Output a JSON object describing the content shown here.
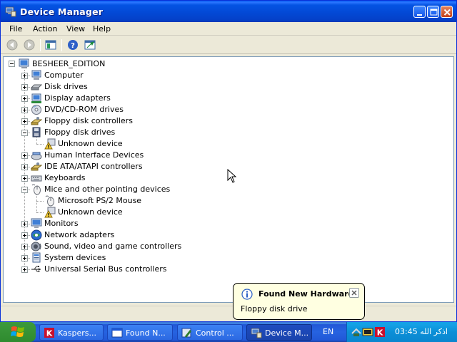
{
  "window": {
    "title": "Device Manager"
  },
  "menubar": {
    "items": [
      "File",
      "Action",
      "View",
      "Help"
    ]
  },
  "tree": {
    "root": "BESHEER_EDITION",
    "items": [
      {
        "label": "Computer",
        "icon": "computer-icon",
        "level": 1,
        "expander": "plus"
      },
      {
        "label": "Disk drives",
        "icon": "disk-drive-icon",
        "level": 1,
        "expander": "plus"
      },
      {
        "label": "Display adapters",
        "icon": "display-adapter-icon",
        "level": 1,
        "expander": "plus"
      },
      {
        "label": "DVD/CD-ROM drives",
        "icon": "cdrom-icon",
        "level": 1,
        "expander": "plus"
      },
      {
        "label": "Floppy disk controllers",
        "icon": "controller-icon",
        "level": 1,
        "expander": "plus"
      },
      {
        "label": "Floppy disk drives",
        "icon": "floppy-drive-icon",
        "level": 1,
        "expander": "minus"
      },
      {
        "label": "Unknown device",
        "icon": "unknown-device-warning-icon",
        "level": 2,
        "expander": "none"
      },
      {
        "label": "Human Interface Devices",
        "icon": "hid-icon",
        "level": 1,
        "expander": "plus"
      },
      {
        "label": "IDE ATA/ATAPI controllers",
        "icon": "controller-icon",
        "level": 1,
        "expander": "plus"
      },
      {
        "label": "Keyboards",
        "icon": "keyboard-icon",
        "level": 1,
        "expander": "plus"
      },
      {
        "label": "Mice and other pointing devices",
        "icon": "mouse-icon",
        "level": 1,
        "expander": "minus"
      },
      {
        "label": "Microsoft PS/2 Mouse",
        "icon": "mouse-icon",
        "level": 2,
        "expander": "none"
      },
      {
        "label": "Unknown device",
        "icon": "unknown-device-warning-icon",
        "level": 2,
        "expander": "none"
      },
      {
        "label": "Monitors",
        "icon": "monitor-icon",
        "level": 1,
        "expander": "plus"
      },
      {
        "label": "Network adapters",
        "icon": "network-adapter-icon",
        "level": 1,
        "expander": "plus"
      },
      {
        "label": "Sound, video and game controllers",
        "icon": "sound-icon",
        "level": 1,
        "expander": "plus"
      },
      {
        "label": "System devices",
        "icon": "system-device-icon",
        "level": 1,
        "expander": "plus"
      },
      {
        "label": "Universal Serial Bus controllers",
        "icon": "usb-icon",
        "level": 1,
        "expander": "plus"
      }
    ]
  },
  "balloon": {
    "title": "Found New Hardware",
    "text": "Floppy disk drive"
  },
  "taskbar": {
    "tasks": [
      {
        "label": "Kaspers...",
        "icon": "kaspersky-icon",
        "active": false
      },
      {
        "label": "Found N...",
        "icon": "window-icon",
        "active": false
      },
      {
        "label": "Control ...",
        "icon": "control-panel-icon",
        "active": false
      },
      {
        "label": "Device M...",
        "icon": "device-manager-icon",
        "active": true
      }
    ],
    "language": "EN",
    "clock": "03:45 اذكر الله"
  }
}
